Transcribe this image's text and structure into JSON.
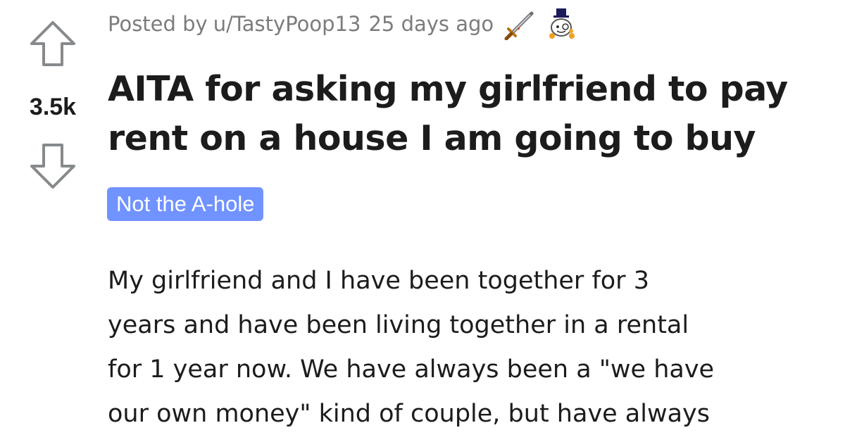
{
  "vote": {
    "score": "3.5k",
    "upvote_icon": "arrow-up-outline-icon",
    "downvote_icon": "arrow-down-outline-icon"
  },
  "meta": {
    "posted_by_label": "Posted by",
    "author": "u/TastyPoop13",
    "time": "25 days ago",
    "awards": [
      {
        "icon": "sword-award-icon"
      },
      {
        "icon": "top-hat-snoo-award-icon"
      }
    ]
  },
  "post": {
    "title": "AITA for asking my girlfriend to pay rent on a house I am going to buy",
    "flair": "Not the A-hole",
    "body_lines": [
      "My girlfriend and I have been together for 3",
      "years and have been living together in a rental",
      "for 1 year now. We have always been a \"we have",
      "our own money\" kind of couple, but have always"
    ]
  },
  "colors": {
    "flair_bg": "#7193ff",
    "meta_text": "#7c7c7c",
    "text": "#1c1c1c",
    "icon_stroke": "#878a8c"
  }
}
